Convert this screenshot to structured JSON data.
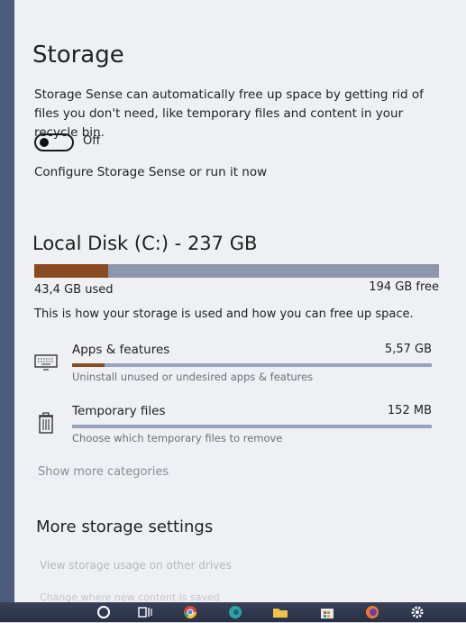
{
  "storage": {
    "title": "Storage",
    "description": "Storage Sense can automatically free up space by getting rid of files you don't need, like temporary files and content in your recycle bin.",
    "toggle_label": "Off",
    "configure_link": "Configure Storage Sense or run it now"
  },
  "disk": {
    "title": "Local Disk (C:) - 237 GB",
    "used_label": "43,4 GB used",
    "free_label": "194 GB free",
    "used_fraction": 0.183,
    "info": "This is how your storage is used and how you can free up space."
  },
  "categories": [
    {
      "name": "Apps & features",
      "size": "5,57 GB",
      "subtitle": "Uninstall unused or undesired apps & features",
      "icon": "apps-features-icon",
      "fraction": 0.09
    },
    {
      "name": "Temporary files",
      "size": "152 MB",
      "subtitle": "Choose which temporary files to remove",
      "icon": "trash-icon",
      "fraction": 0.0
    }
  ],
  "show_more": "Show more categories",
  "more_settings": {
    "title": "More storage settings",
    "links": [
      "View storage usage on other drives",
      "Change where new content is saved"
    ]
  },
  "colors": {
    "accent": "#8a4a1f",
    "bar_bg": "#8e96ae",
    "panel_bg": "#eef0f3"
  },
  "taskbar": {
    "icons": [
      "cortana-search-icon",
      "task-view-icon",
      "chrome-icon",
      "edge-icon",
      "file-explorer-icon",
      "store-icon",
      "firefox-icon",
      "settings-icon"
    ]
  }
}
